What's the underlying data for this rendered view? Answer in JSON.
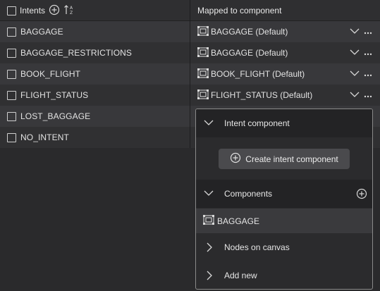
{
  "header": {
    "intents_label": "Intents",
    "mapped_label": "Mapped to component"
  },
  "rows": [
    {
      "intent": "BAGGAGE",
      "component": "BAGGAGE (Default)"
    },
    {
      "intent": "BAGGAGE_RESTRICTIONS",
      "component": "BAGGAGE (Default)"
    },
    {
      "intent": "BOOK_FLIGHT",
      "component": "BOOK_FLIGHT (Default)"
    },
    {
      "intent": "FLIGHT_STATUS",
      "component": "FLIGHT_STATUS (Default)"
    },
    {
      "intent": "LOST_BAGGAGE",
      "component": ""
    },
    {
      "intent": "NO_INTENT",
      "component": ""
    }
  ],
  "dropdown": {
    "intent_component_label": "Intent component",
    "create_button_label": "Create intent component",
    "components_label": "Components",
    "component_items": [
      "BAGGAGE"
    ],
    "nodes_label": "Nodes on canvas",
    "add_new_label": "Add new"
  },
  "icons": {
    "component": "component-icon",
    "add": "add-circle-icon",
    "sort": "sort-alpha-icon",
    "chevron_down": "chevron-down-icon",
    "chevron_right": "chevron-right-icon",
    "more": "more-horizontal-icon"
  },
  "colors": {
    "background": "#2a2a2c",
    "row_alt": "#38383b",
    "row_plain": "#303032",
    "text": "#e6e6e6",
    "dropdown_border": "#8a8a8a"
  }
}
